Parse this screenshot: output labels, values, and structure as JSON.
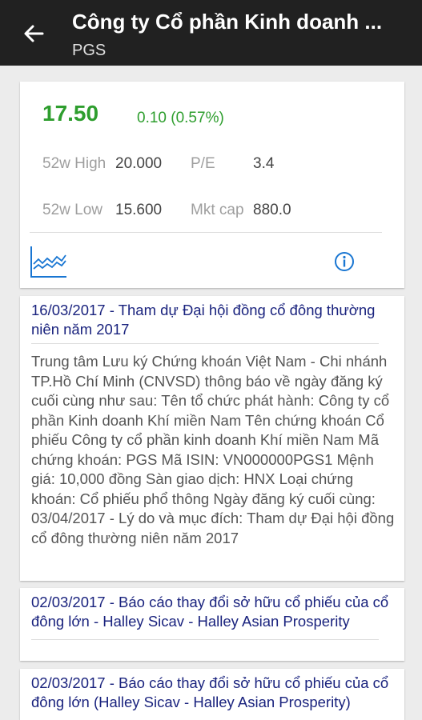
{
  "header": {
    "title": "Công ty Cổ phần Kinh doanh ...",
    "subtitle": "PGS"
  },
  "quote": {
    "price": "17.50",
    "change": "0.10 (0.57%)",
    "high_label": "52w High",
    "high_value": "20.000",
    "pe_label": "P/E",
    "pe_value": "3.4",
    "low_label": "52w Low",
    "low_value": "15.600",
    "mktcap_label": "Mkt cap",
    "mktcap_value": "880.0"
  },
  "news": [
    {
      "title": "16/03/2017 - Tham dự Đại hội đồng cổ đông thường niên năm 2017",
      "body": "Trung tâm Lưu ký Chứng khoán Việt Nam - Chi nhánh TP.Hồ Chí Minh (CNVSD) thông báo về ngày đăng ký cuối cùng như sau: Tên tổ chức phát hành: Công ty cổ phần Kinh doanh Khí miền Nam Tên chứng khoán Cổ phiếu Công ty cổ phần kinh doanh Khí miền Nam Mã chứng khoán: PGS Mã ISIN: VN000000PGS1 Mệnh giá: 10,000 đồng Sàn giao dịch: HNX Loại chứng khoán: Cổ phiếu phổ thông Ngày đăng ký cuối cùng: 03/04/2017 - Lý do và mục đích: Tham dự Đại hội đồng cổ đông thường niên năm 2017"
    },
    {
      "title": "02/03/2017 - Báo cáo thay đổi sở hữu cổ phiếu của cổ đông lớn - Halley Sicav - Halley Asian Prosperity"
    },
    {
      "title": "02/03/2017 - Báo cáo thay đổi sở hữu cổ phiếu của cổ đông lớn (Halley Sicav - Halley Asian Prosperity)"
    }
  ],
  "colors": {
    "appbar": "#212121",
    "price_up": "#2e9e2e",
    "link": "#1a237e",
    "icon_blue": "#1976d2"
  }
}
